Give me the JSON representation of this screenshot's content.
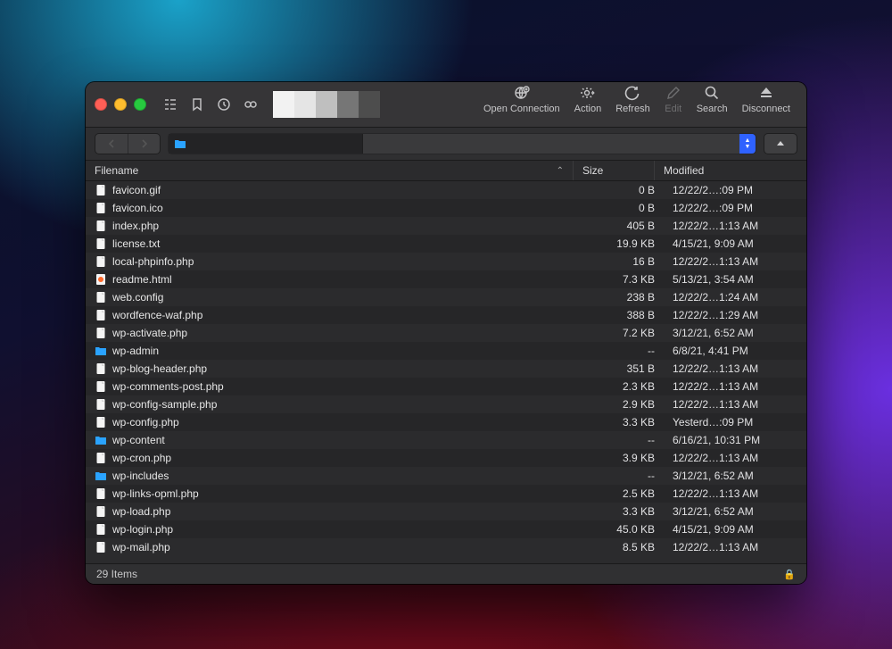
{
  "toolbar": {
    "open_connection": "Open Connection",
    "action": "Action",
    "refresh": "Refresh",
    "edit": "Edit",
    "search": "Search",
    "disconnect": "Disconnect"
  },
  "columns": {
    "filename": "Filename",
    "size": "Size",
    "modified": "Modified"
  },
  "files": [
    {
      "name": "favicon.gif",
      "type": "file",
      "size": "0 B",
      "modified": "12/22/2…:09 PM"
    },
    {
      "name": "favicon.ico",
      "type": "file",
      "size": "0 B",
      "modified": "12/22/2…:09 PM"
    },
    {
      "name": "index.php",
      "type": "file",
      "size": "405 B",
      "modified": "12/22/2…1:13 AM"
    },
    {
      "name": "license.txt",
      "type": "file",
      "size": "19.9 KB",
      "modified": "4/15/21, 9:09 AM"
    },
    {
      "name": "local-phpinfo.php",
      "type": "file",
      "size": "16 B",
      "modified": "12/22/2…1:13 AM"
    },
    {
      "name": "readme.html",
      "type": "html",
      "size": "7.3 KB",
      "modified": "5/13/21, 3:54 AM"
    },
    {
      "name": "web.config",
      "type": "file",
      "size": "238 B",
      "modified": "12/22/2…1:24 AM"
    },
    {
      "name": "wordfence-waf.php",
      "type": "file",
      "size": "388 B",
      "modified": "12/22/2…1:29 AM"
    },
    {
      "name": "wp-activate.php",
      "type": "file",
      "size": "7.2 KB",
      "modified": "3/12/21, 6:52 AM"
    },
    {
      "name": "wp-admin",
      "type": "folder",
      "size": "--",
      "modified": "6/8/21, 4:41 PM"
    },
    {
      "name": "wp-blog-header.php",
      "type": "file",
      "size": "351 B",
      "modified": "12/22/2…1:13 AM"
    },
    {
      "name": "wp-comments-post.php",
      "type": "file",
      "size": "2.3 KB",
      "modified": "12/22/2…1:13 AM"
    },
    {
      "name": "wp-config-sample.php",
      "type": "file",
      "size": "2.9 KB",
      "modified": "12/22/2…1:13 AM"
    },
    {
      "name": "wp-config.php",
      "type": "file",
      "size": "3.3 KB",
      "modified": "Yesterd…:09 PM"
    },
    {
      "name": "wp-content",
      "type": "folder",
      "size": "--",
      "modified": "6/16/21, 10:31 PM"
    },
    {
      "name": "wp-cron.php",
      "type": "file",
      "size": "3.9 KB",
      "modified": "12/22/2…1:13 AM"
    },
    {
      "name": "wp-includes",
      "type": "folder",
      "size": "--",
      "modified": "3/12/21, 6:52 AM"
    },
    {
      "name": "wp-links-opml.php",
      "type": "file",
      "size": "2.5 KB",
      "modified": "12/22/2…1:13 AM"
    },
    {
      "name": "wp-load.php",
      "type": "file",
      "size": "3.3 KB",
      "modified": "3/12/21, 6:52 AM"
    },
    {
      "name": "wp-login.php",
      "type": "file",
      "size": "45.0 KB",
      "modified": "4/15/21, 9:09 AM"
    },
    {
      "name": "wp-mail.php",
      "type": "file",
      "size": "8.5 KB",
      "modified": "12/22/2…1:13 AM"
    }
  ],
  "status": {
    "count_label": "29 Items"
  },
  "swatches": [
    "#f2f2f2",
    "#e5e5e5",
    "#bfbfbf",
    "#767676",
    "#4d4d4d"
  ],
  "sort_indicator": "⌃"
}
